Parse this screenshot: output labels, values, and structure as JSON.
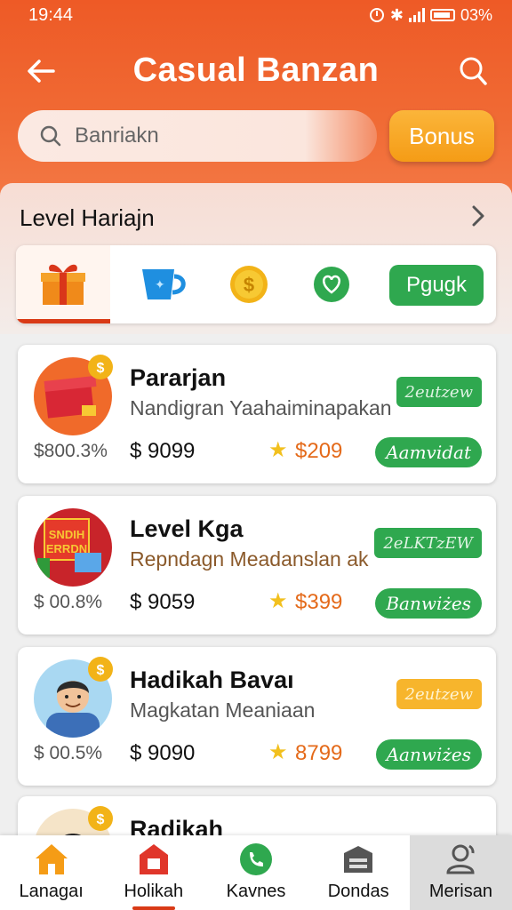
{
  "status": {
    "time": "19:44",
    "battery": "03%"
  },
  "header": {
    "title": "Casual Banzan",
    "search_placeholder": "Banriakn",
    "bonus_label": "Bonus"
  },
  "level": {
    "title": "Level Hariajn",
    "go_label": "Pgugk"
  },
  "cards": [
    {
      "name": "Pararjan",
      "desc": "Nandigran Yaahaiminapakan",
      "pct": "$800.3%",
      "price": "$ 9099",
      "reward": "$209",
      "tag": "2eutzew",
      "action": "Aamvidat",
      "thumb_icon": "gift-box-icon"
    },
    {
      "name": "Level Kga",
      "desc": "Repndagn Meadanslan ak",
      "pct": "$ 00.8%",
      "price": "$ 9059",
      "reward": "$399",
      "tag": "2eLKTzEW",
      "action": "Banwiżes",
      "thumb_icon": "poster-icon"
    },
    {
      "name": "Hadikah Bavaı",
      "desc": "Magkatan Meaniaan",
      "pct": "$ 00.5%",
      "price": "$ 9090",
      "reward": "8799",
      "tag": "2eutzew",
      "action": "Aanwiżes",
      "thumb_icon": "man-avatar-icon"
    },
    {
      "name": "Radikah"
    }
  ],
  "nav": [
    {
      "label": "Lanagaı",
      "icon": "home-icon"
    },
    {
      "label": "Holikah",
      "icon": "shop-icon"
    },
    {
      "label": "Kavnes",
      "icon": "phone-icon"
    },
    {
      "label": "Dondas",
      "icon": "store-icon"
    },
    {
      "label": "Merisan",
      "icon": "profile-refresh-icon"
    }
  ],
  "colors": {
    "primary": "#ee5a26",
    "accent_green": "#2fa84f",
    "bonus_orange": "#f7a420",
    "active_red": "#d93a16"
  }
}
